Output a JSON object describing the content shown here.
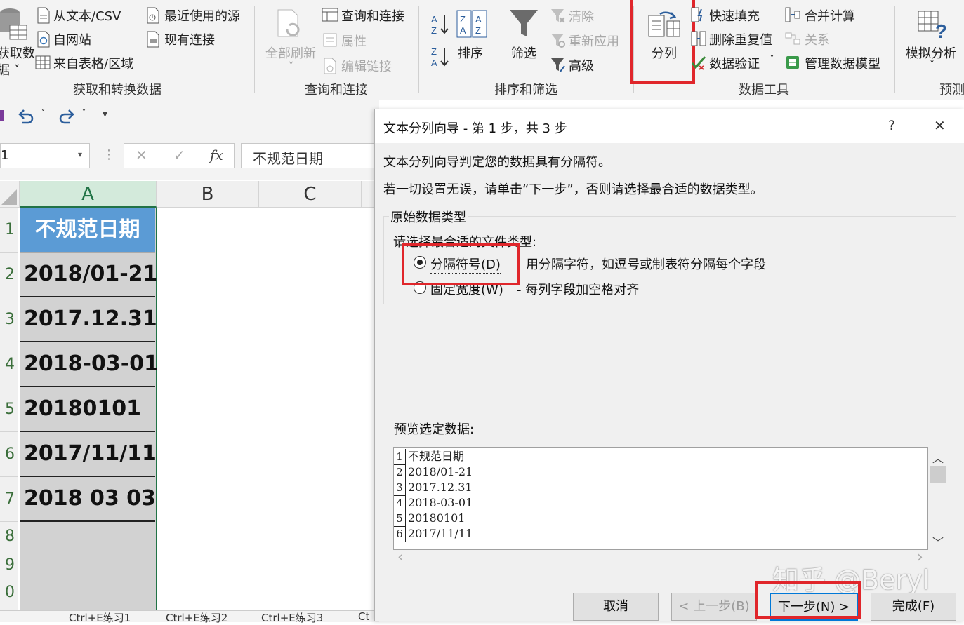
{
  "ribbon": {
    "get_data": {
      "label_line1": "获取数",
      "label_line2": "据 ˇ"
    },
    "from_text_csv": "从文本/CSV",
    "from_web": "自网站",
    "from_table": "来自表格/区域",
    "recent_sources": "最近使用的源",
    "existing_connections": "现有连接",
    "group_get_transform": "获取和转换数据",
    "refresh_all": "全部刷新",
    "refresh_all_arrow": "ˇ",
    "queries_connections": "查询和连接",
    "properties": "属性",
    "edit_links": "编辑链接",
    "group_queries": "查询和连接",
    "sort": "排序",
    "filter": "筛选",
    "clear": "清除",
    "reapply": "重新应用",
    "advanced": "高级",
    "group_sort_filter": "排序和筛选",
    "text_to_columns": "分列",
    "flash_fill": "快速填充",
    "remove_duplicates": "删除重复值",
    "data_validation": "数据验证",
    "data_validation_arrow": "ˇ",
    "consolidate": "合并计算",
    "relationships": "关系",
    "manage_data_model": "管理数据模型",
    "group_data_tools": "数据工具",
    "what_if": "模拟分析",
    "what_if_arrow": "ˇ",
    "group_forecast": "预测"
  },
  "qat": {
    "undo_arrow": "ˇ",
    "redo_arrow": "ˇ",
    "customize": "▾"
  },
  "formula_bar": {
    "name_box": "1",
    "fx": "fx",
    "cancel": "✕",
    "enter": "✓",
    "content": "不规范日期"
  },
  "grid": {
    "columns": [
      "A",
      "B",
      "C"
    ],
    "row_numbers": [
      "1",
      "2",
      "3",
      "4",
      "5",
      "6",
      "7",
      "8",
      "9",
      "0"
    ],
    "header_cell": "不规范日期",
    "cells": [
      "2018/01-21",
      "2017.12.31",
      "2018-03-01",
      "20180101",
      "2017/11/11",
      "2018 03 03"
    ]
  },
  "sheet_tabs": [
    "Ctrl+E练习1",
    "Ctrl+E练习2",
    "Ctrl+E练习3",
    "Ct"
  ],
  "dialog": {
    "title": "文本分列向导 - 第 1 步，共 3 步",
    "help": "?",
    "close": "✕",
    "line1": "文本分列向导判定您的数据具有分隔符。",
    "line2": "若一切设置无误，请单击“下一步”，否则请选择最合适的数据类型。",
    "group_title": "原始数据类型",
    "choose_label": "请选择最合适的文件类型:",
    "option_delimited": "分隔符号(D)",
    "option_delimited_desc": "用分隔字符，如逗号或制表符分隔每个字段",
    "option_fixed": "固定宽度(W)",
    "option_fixed_desc": "- 每列字段加空格对齐",
    "preview_label": "预览选定数据:",
    "preview_lines": [
      {
        "num": "1",
        "text": "不规范日期"
      },
      {
        "num": "2",
        "text": "2018/01-21"
      },
      {
        "num": "3",
        "text": "2017.12.31"
      },
      {
        "num": "4",
        "text": "2018-03-01"
      },
      {
        "num": "5",
        "text": "20180101"
      },
      {
        "num": "6",
        "text": "2017/11/11"
      }
    ],
    "scroll_up": "︿",
    "scroll_down": "﹀",
    "scroll_left": "‹",
    "scroll_right": "›",
    "btn_cancel": "取消",
    "btn_back": "< 上一步(B)",
    "btn_next": "下一步(N) >",
    "btn_finish": "完成(F)",
    "selected_option": "delimited"
  },
  "watermark": "知乎 @Beryl",
  "colors": {
    "header_blue": "#5b9bd5",
    "cell_grey": "#d2d2d2",
    "highlight_red": "#e0262b",
    "selected_col_green": "#217346"
  }
}
